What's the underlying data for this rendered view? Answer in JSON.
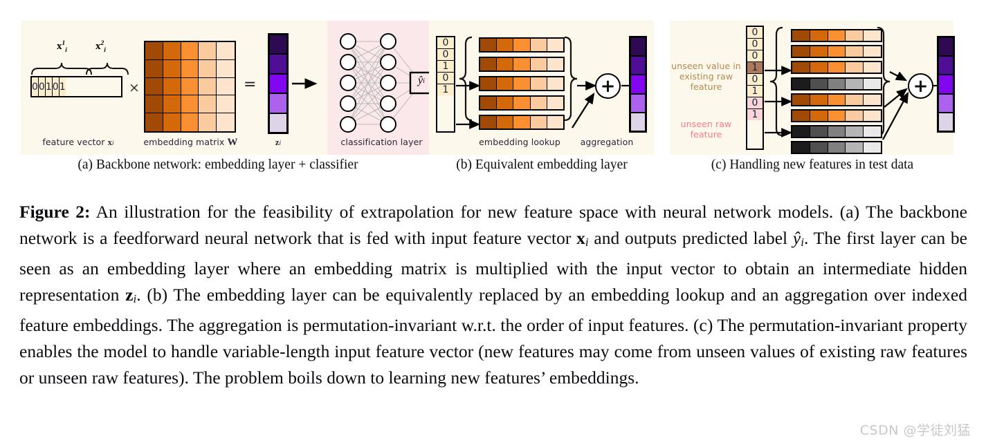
{
  "figure": {
    "panels": [
      {
        "id": "a",
        "caption": "(a) Backbone network: embedding layer + classifier",
        "feature_vector_label": "feature vector",
        "feature_vector_symbol": "x",
        "feature_vector_sub": "i",
        "feature_bits": [
          "0",
          "0",
          "1",
          "0",
          "1"
        ],
        "brace_labels": [
          {
            "symbol": "x",
            "sup": "1",
            "sub": "i"
          },
          {
            "symbol": "x",
            "sup": "2",
            "sub": "i"
          }
        ],
        "times_symbol": "×",
        "equals_symbol": "=",
        "matrix_label": "embedding matrix",
        "matrix_symbol": "W",
        "matrix_rows": 5,
        "matrix_cols": 5,
        "z_label": "z",
        "z_sub": "i",
        "z_cells": 5,
        "classifier_label": "classification layer",
        "classifier_input_nodes": 5,
        "classifier_hidden_nodes": 5,
        "output_label": "ŷ",
        "output_sub": "i"
      },
      {
        "id": "b",
        "caption": "(b) Equivalent embedding layer",
        "bits": [
          "0",
          "0",
          "1",
          "0",
          "1"
        ],
        "active_indices": [
          2,
          4
        ],
        "lookup_label": "embedding lookup",
        "aggregation_label": "aggregation",
        "plus_symbol": "+",
        "rows": 5,
        "cols": 5,
        "out_cells": 5
      },
      {
        "id": "c",
        "caption": "(c) Handling new features in test data",
        "bits": [
          "0",
          "0",
          "0",
          "1",
          "0",
          "1",
          "0",
          "1"
        ],
        "active_indices": [
          3,
          5,
          7
        ],
        "gray_row_indices": [
          3,
          6,
          7
        ],
        "annotation_unseen_value": "unseen value in\nexisting raw\nfeature",
        "annotation_unseen_feature": "unseen raw\nfeature",
        "plus_symbol": "+",
        "rows": 8,
        "cols": 5,
        "out_cells": 5
      }
    ]
  },
  "colors": {
    "panel_background": "#fdf8ec",
    "classifier_background": "#fbe9ea",
    "bit_cell": "#fdeecb",
    "unseen_value_cell": "#ab7a5f",
    "unseen_feature_cell": "#f8d5d8",
    "annotation_unseen_value": "#b4884e",
    "annotation_unseen_feature": "#fb7a85",
    "orange_scale": [
      "#a04a06",
      "#d4690c",
      "#fb9033",
      "#fbcba0",
      "#fde4cd"
    ],
    "gray_scale": [
      "#1c1c1c",
      "#4f4f4f",
      "#808080",
      "#b5b5b5",
      "#e9e9e9"
    ],
    "purple_scale": [
      "#2d0a52",
      "#4e0f96",
      "#8207f0",
      "#ad62ee",
      "#ded4e8"
    ],
    "watermark": "#c8c8c8"
  },
  "caption": {
    "label": "Figure 2:",
    "text_1": " An illustration for the feasibility of extrapolation for new feature space with neural network models. (a) The backbone network is a feedforward neural network that is fed with input feature vector ",
    "math_x": "x",
    "math_x_sub": "i",
    "text_2": " and outputs predicted label ",
    "math_y": "ŷ",
    "math_y_sub": "i",
    "text_3": ". The first layer can be seen as an embedding layer where an embedding matrix is multiplied with the input vector to obtain an intermediate hidden representation ",
    "math_z": "z",
    "math_z_sub": "i",
    "text_4": ". (b) The embedding layer can be equivalently replaced by an embedding lookup and an aggregation over indexed feature embeddings. The aggregation is permutation-invariant w.r.t. the order of input features. (c) The permutation-invariant property enables the model to handle variable-length input feature vector (new features may come from unseen values of existing raw features or unseen raw features). The problem boils down to learning new features’ embeddings."
  },
  "watermark": "CSDN @学徒刘猛"
}
